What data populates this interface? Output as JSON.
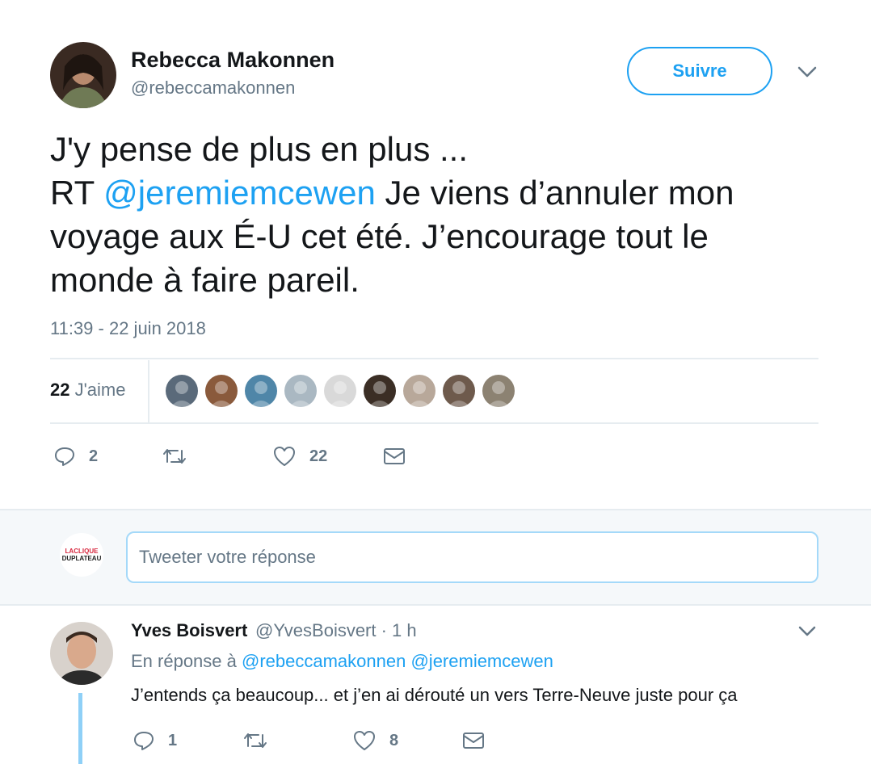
{
  "tweet": {
    "author_name": "Rebecca Makonnen",
    "author_handle": "@rebeccamakonnen",
    "follow_label": "Suivre",
    "text_line1": "J'y pense de plus en plus ...",
    "text_rt": "RT",
    "text_mention": "@jeremiemcewen",
    "text_rest_line2": " Je viens d’annuler mon",
    "text_line3": "voyage aux É-U cet été. J’encourage tout le",
    "text_line4": "monde à faire pareil.",
    "timestamp": "11:39 - 22 juin 2018",
    "likes_count": "22",
    "likes_label": "J'aime",
    "actions": {
      "reply_count": "2",
      "retweet_count": "",
      "like_count": "22"
    }
  },
  "composer": {
    "placeholder": "Tweeter votre réponse",
    "logo_line1": "LACLIQUE",
    "logo_line2": "DUPLATEAU"
  },
  "reply": {
    "author_name": "Yves Boisvert",
    "author_handle_time": "@YvesBoisvert · 1 h",
    "replying_prefix": "En réponse à",
    "replying_mention1": "@rebeccamakonnen",
    "replying_mention2": "@jeremiemcewen",
    "text": "J’entends ça beaucoup... et j’en ai dérouté un vers Terre-Neuve juste pour ça",
    "actions": {
      "reply_count": "1",
      "retweet_count": "",
      "like_count": "8"
    }
  },
  "colors": {
    "accent": "#1da1f2",
    "muted": "#657786",
    "text": "#14171a",
    "divider": "#e6ecf0",
    "thread_line": "#8fd0f7"
  },
  "likers": [
    {
      "name": "liker-1-avatar",
      "color": "#5a6a7a"
    },
    {
      "name": "liker-2-avatar",
      "color": "#8a5a3c"
    },
    {
      "name": "liker-3-avatar",
      "color": "#4f86a8"
    },
    {
      "name": "liker-4-avatar",
      "color": "#aab8c2"
    },
    {
      "name": "liker-5-avatar",
      "color": "#d9d9d9"
    },
    {
      "name": "liker-6-avatar",
      "color": "#3b2e25"
    },
    {
      "name": "liker-7-avatar",
      "color": "#b8a89a"
    },
    {
      "name": "liker-8-avatar",
      "color": "#6e5a4c"
    },
    {
      "name": "liker-9-avatar",
      "color": "#8c8272"
    }
  ]
}
